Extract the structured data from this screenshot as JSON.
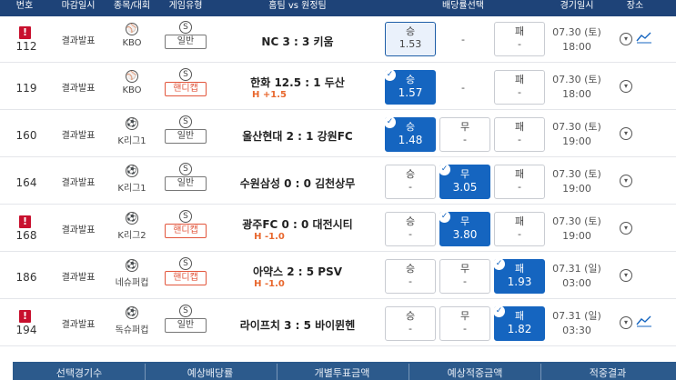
{
  "header": {
    "col_no": "번호",
    "col_deadline": "마감일시",
    "col_sport": "종목/대회",
    "col_gametype": "게임유형",
    "col_match": "홈팀 vs 원정팀",
    "col_odds": "배당률선택",
    "col_date": "경기일시",
    "col_place": "장소"
  },
  "rows": [
    {
      "no": "112",
      "flag": "!",
      "deadline": "결과발표",
      "league": "KBO",
      "type_icon": "S",
      "game_type": "일반",
      "match": "NC 3 : 3 키움",
      "handicap": "",
      "win": {
        "label": "승",
        "value": "1.53"
      },
      "draw": {
        "label": "",
        "value": "-"
      },
      "lose": {
        "label": "패",
        "value": "-"
      },
      "date": "07.30 (토)",
      "time": "18:00"
    },
    {
      "no": "119",
      "flag": "",
      "deadline": "결과발표",
      "league": "KBO",
      "type_icon": "S",
      "game_type": "핸디캡",
      "match": "한화 12.5 : 1 두산",
      "handicap": "H +1.5",
      "win": {
        "label": "승",
        "value": "1.57"
      },
      "draw": {
        "label": "",
        "value": "-"
      },
      "lose": {
        "label": "패",
        "value": "-"
      },
      "date": "07.30 (토)",
      "time": "18:00"
    },
    {
      "no": "160",
      "flag": "",
      "deadline": "결과발표",
      "league": "K리그1",
      "type_icon": "S",
      "game_type": "일반",
      "match": "울산현대 2 : 1 강원FC",
      "handicap": "",
      "win": {
        "label": "승",
        "value": "1.48"
      },
      "draw": {
        "label": "무",
        "value": "-"
      },
      "lose": {
        "label": "패",
        "value": "-"
      },
      "date": "07.30 (토)",
      "time": "19:00"
    },
    {
      "no": "164",
      "flag": "",
      "deadline": "결과발표",
      "league": "K리그1",
      "type_icon": "S",
      "game_type": "일반",
      "match": "수원삼성 0 : 0 김천상무",
      "handicap": "",
      "win": {
        "label": "승",
        "value": "-"
      },
      "draw": {
        "label": "무",
        "value": "3.05"
      },
      "lose": {
        "label": "패",
        "value": "-"
      },
      "date": "07.30 (토)",
      "time": "19:00"
    },
    {
      "no": "168",
      "flag": "!",
      "deadline": "결과발표",
      "league": "K리그2",
      "type_icon": "S",
      "game_type": "핸디캡",
      "match": "광주FC 0 : 0 대전시티",
      "handicap": "H -1.0",
      "win": {
        "label": "승",
        "value": "-"
      },
      "draw": {
        "label": "무",
        "value": "3.80"
      },
      "lose": {
        "label": "패",
        "value": "-"
      },
      "date": "07.30 (토)",
      "time": "19:00"
    },
    {
      "no": "186",
      "flag": "",
      "deadline": "결과발표",
      "league": "네슈퍼컵",
      "type_icon": "S",
      "game_type": "핸디캡",
      "match": "아약스 2 : 5 PSV",
      "handicap": "H -1.0",
      "win": {
        "label": "승",
        "value": "-"
      },
      "draw": {
        "label": "무",
        "value": "-"
      },
      "lose": {
        "label": "패",
        "value": "1.93"
      },
      "date": "07.31 (일)",
      "time": "03:00"
    },
    {
      "no": "194",
      "flag": "!",
      "deadline": "결과발표",
      "league": "독슈퍼컵",
      "type_icon": "S",
      "game_type": "일반",
      "match": "라이프치 3 : 5 바이뮌헨",
      "handicap": "",
      "win": {
        "label": "승",
        "value": "-"
      },
      "draw": {
        "label": "무",
        "value": "-"
      },
      "lose": {
        "label": "패",
        "value": "1.82"
      },
      "date": "07.31 (일)",
      "time": "03:30"
    }
  ],
  "footer": {
    "selected_count": "선택경기수",
    "expected_odds": "예상배당률",
    "stake": "개별투표금액",
    "expected_win": "예상적중금액",
    "result": "적중결과"
  },
  "colors": {
    "header_bg": "#1e4378",
    "selected_odd": "#1565c0",
    "handicap": "#e2563c",
    "flag": "#c8102e"
  },
  "icons": {
    "flag": "alert-flag-icon",
    "sport_baseball": "baseball-icon",
    "sport_soccer": "soccer-ball-icon",
    "place": "location-pin-icon",
    "trend": "trend-chart-icon",
    "check": "check-icon"
  }
}
